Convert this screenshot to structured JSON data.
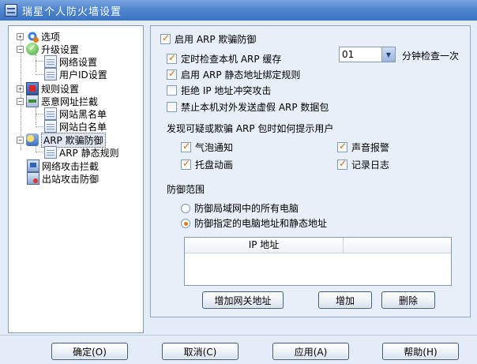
{
  "window": {
    "title": "瑞星个人防火墙设置"
  },
  "tree": {
    "options": "选项",
    "upgrade": "升级设置",
    "network_settings": "网络设置",
    "user_id_settings": "用户ID设置",
    "rules": "规则设置",
    "malicious_url": "恶意网址拦截",
    "blacklist": "网站黑名单",
    "whitelist": "网站白名单",
    "arp_defense": "ARP 欺骗防御",
    "arp_static": "ARP 静态规则",
    "net_attack": "网络攻击拦截",
    "outbound_attack": "出站攻击防御"
  },
  "panel": {
    "enable_arp": {
      "label": "启用 ARP 欺骗防御",
      "checked": true
    },
    "timed_check": {
      "label": "定时检查本机 ARP 缓存",
      "checked": true
    },
    "interval": {
      "value": "01",
      "suffix": "分钟检查一次"
    },
    "static_binding": {
      "label": "启用 ARP 静态地址绑定规则",
      "checked": true
    },
    "reject_conflict": {
      "label": "拒绝 IP 地址冲突攻击",
      "checked": false
    },
    "block_fake": {
      "label": "禁止本机对外发送虚假 ARP 数据包",
      "checked": false
    },
    "notify_heading": "发现可疑或欺骗 ARP 包时如何提示用户",
    "notify": {
      "bubble": {
        "label": "气泡通知",
        "checked": true
      },
      "sound": {
        "label": "声音报警",
        "checked": true
      },
      "tray": {
        "label": "托盘动画",
        "checked": true
      },
      "log": {
        "label": "记录日志",
        "checked": true
      }
    },
    "scope_heading": "防御范围",
    "scope_all": {
      "label": "防御局域网中的所有电脑",
      "selected": false
    },
    "scope_specified": {
      "label": "防御指定的电脑地址和静态地址",
      "selected": true
    },
    "ip_table": {
      "columns": [
        "IP 地址",
        ""
      ],
      "rows": []
    },
    "buttons": {
      "add_gateway": "增加网关地址",
      "add": "增加",
      "delete": "删除"
    }
  },
  "footer": {
    "ok": "确定(O)",
    "cancel": "取消(C)",
    "apply": "应用(A)",
    "help": "帮助(H)"
  },
  "colors": {
    "check_mark": "#d76f0d",
    "titlebar": "#3a73c2",
    "background": "#e4ecf7"
  }
}
